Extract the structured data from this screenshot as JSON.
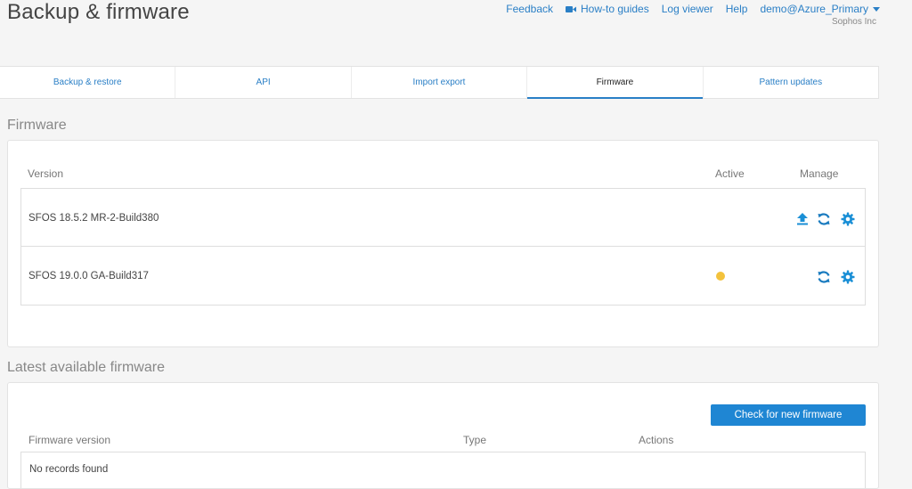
{
  "page": {
    "title": "Backup & firmware"
  },
  "topnav": {
    "feedback": "Feedback",
    "howto": "How-to guides",
    "logviewer": "Log viewer",
    "help": "Help",
    "user": "demo@Azure_Primary",
    "company": "Sophos Inc"
  },
  "tabs": [
    {
      "label": "Backup & restore"
    },
    {
      "label": "API"
    },
    {
      "label": "Import export"
    },
    {
      "label": "Firmware",
      "active": true
    },
    {
      "label": "Pattern updates"
    }
  ],
  "firmware": {
    "title": "Firmware",
    "columns": {
      "version": "Version",
      "active": "Active",
      "manage": "Manage"
    },
    "rows": [
      {
        "version": "SFOS 18.5.2 MR-2-Build380",
        "active": false,
        "icons": [
          "upload-icon",
          "refresh-icon",
          "gear-icon"
        ]
      },
      {
        "version": "SFOS 19.0.0 GA-Build317",
        "active": true,
        "icons": [
          "refresh-icon",
          "gear-icon"
        ]
      }
    ]
  },
  "latest": {
    "title": "Latest available firmware",
    "check_button": "Check for new firmware",
    "columns": {
      "version": "Firmware version",
      "type": "Type",
      "actions": "Actions"
    },
    "empty": "No records found"
  },
  "colors": {
    "accent": "#2a7fc6",
    "button": "#1f86d3",
    "active_dot": "#f3c23c"
  }
}
